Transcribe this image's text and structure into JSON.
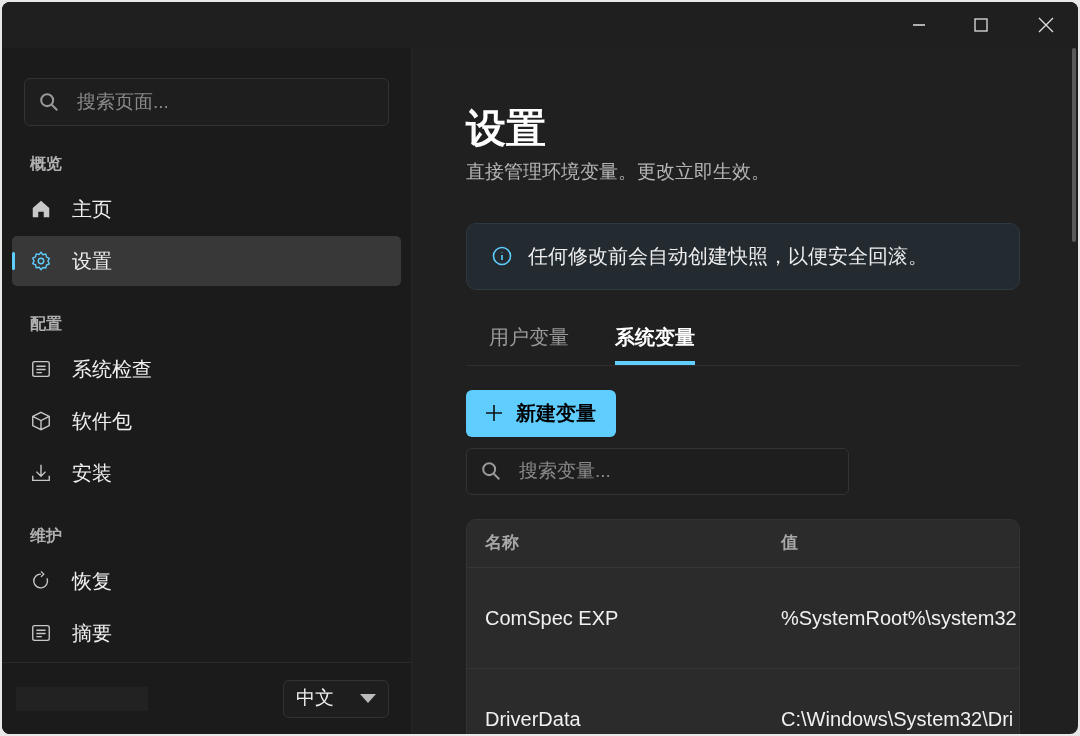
{
  "sidebar": {
    "search": {
      "placeholder": "搜索页面..."
    },
    "sections": [
      {
        "title": "概览",
        "items": [
          {
            "label": "主页",
            "kind": "home",
            "selected": false
          },
          {
            "label": "设置",
            "kind": "gear",
            "selected": true
          }
        ]
      },
      {
        "title": "配置",
        "items": [
          {
            "label": "系统检查",
            "kind": "list",
            "selected": false
          },
          {
            "label": "软件包",
            "kind": "box",
            "selected": false
          },
          {
            "label": "安装",
            "kind": "download",
            "selected": false
          }
        ]
      },
      {
        "title": "维护",
        "items": [
          {
            "label": "恢复",
            "kind": "refresh",
            "selected": false
          },
          {
            "label": "摘要",
            "kind": "list",
            "selected": false
          }
        ]
      }
    ],
    "language": {
      "value": "中文"
    }
  },
  "page": {
    "title": "设置",
    "subtitle": "直接管理环境变量。更改立即生效。",
    "notice": "任何修改前会自动创建快照，以便安全回滚。",
    "tabs": [
      {
        "label": "用户变量",
        "selected": false
      },
      {
        "label": "系统变量",
        "selected": true
      }
    ],
    "new_button": "新建变量",
    "search": {
      "placeholder": "搜索变量..."
    },
    "table": {
      "columns": [
        "名称",
        "值"
      ],
      "rows": [
        {
          "name": "ComSpec EXP",
          "value": "%SystemRoot%\\system32"
        },
        {
          "name": "DriverData",
          "value": "C:\\Windows\\System32\\Dri"
        }
      ]
    }
  }
}
